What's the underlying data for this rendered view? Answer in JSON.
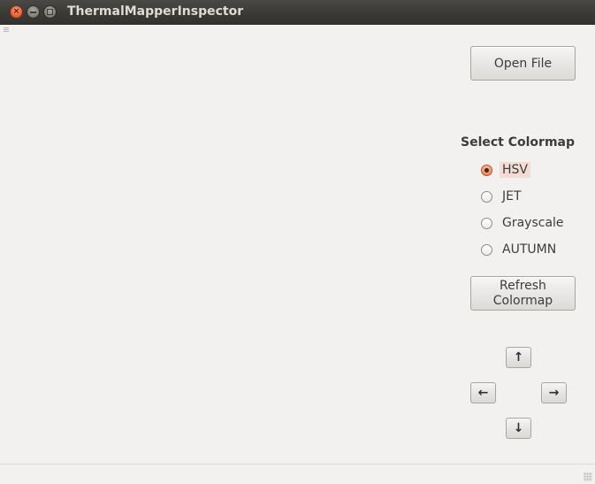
{
  "window": {
    "title": "ThermalMapperInspector"
  },
  "toolbar": {
    "open_file_label": "Open File",
    "refresh_label": "Refresh\nColormap"
  },
  "colormap": {
    "heading": "Select Colormap",
    "selected": "HSV",
    "options": [
      {
        "label": "HSV",
        "checked": true
      },
      {
        "label": "JET",
        "checked": false
      },
      {
        "label": "Grayscale",
        "checked": false
      },
      {
        "label": "AUTUMN",
        "checked": false
      }
    ]
  },
  "navigation": {
    "up": "↑",
    "left": "←",
    "right": "→",
    "down": "↓"
  },
  "colors": {
    "titlebar": "#3b3a36",
    "background": "#f2f1f0",
    "accent": "#e8592b",
    "selection": "#f3dcd3"
  }
}
